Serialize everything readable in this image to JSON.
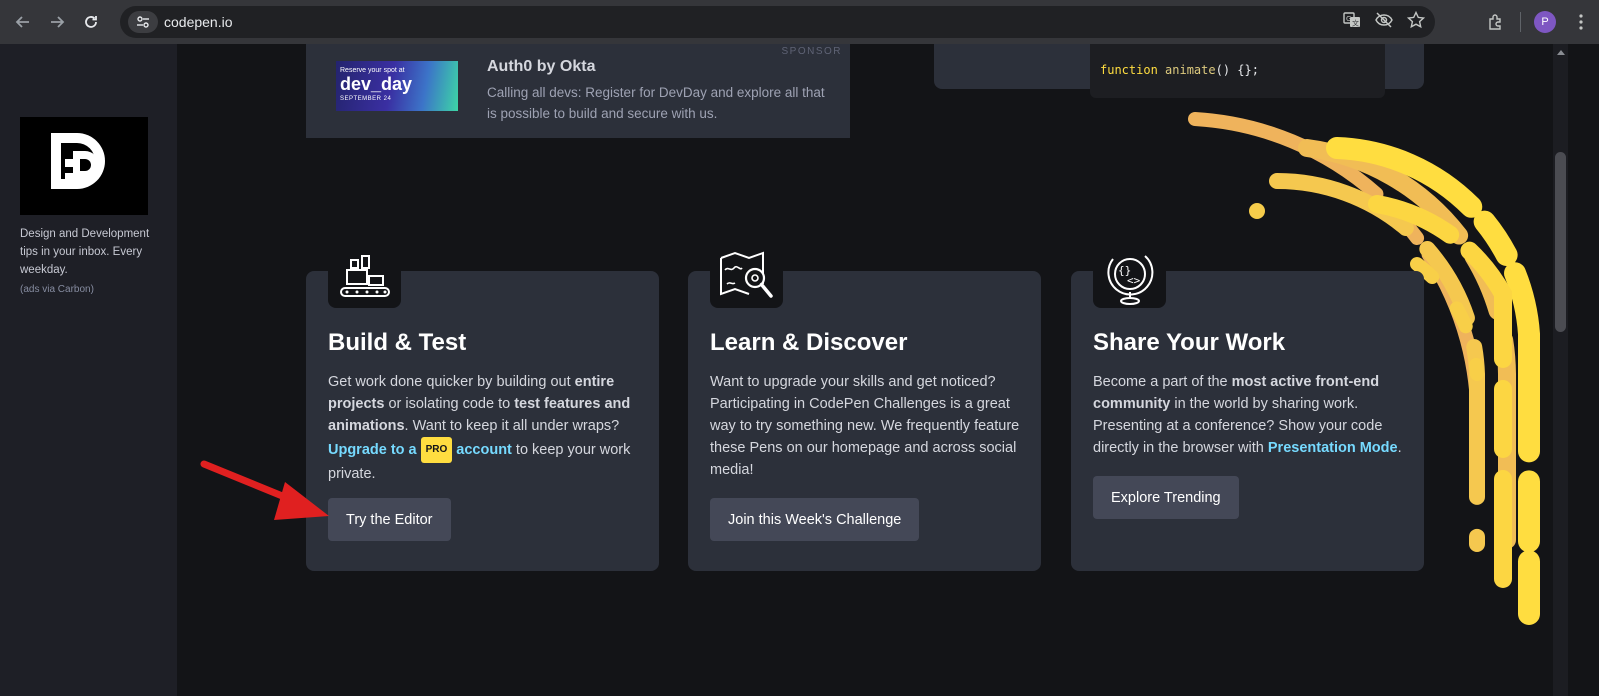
{
  "browser": {
    "url": "codepen.io",
    "profile_initial": "P"
  },
  "sidebar": {
    "ad_text": "Design and Development tips in your inbox. Every weekday.",
    "ad_via": "(ads via Carbon)"
  },
  "sponsor": {
    "tag": "SPONSOR",
    "image_small": "Reserve your spot at",
    "image_big": "dev_day",
    "image_date": "SEPTEMBER 24",
    "title": "Auth0 by Okta",
    "description": "Calling all devs: Register for DevDay and explore all that is possible to build and secure with us."
  },
  "code_snippet": {
    "keyword": "function",
    "name": "animate",
    "rest": "() {};"
  },
  "cards": [
    {
      "title": "Build & Test",
      "body": {
        "t1": "Get work done quicker by building out ",
        "b1": "entire projects",
        "t2": " or isolating code to ",
        "b2": "test features and animations",
        "t3": ". Want to keep it all under wraps? ",
        "link1": "Upgrade to a",
        "pro": "PRO",
        "link2": "account",
        "t4": " to keep your work private."
      },
      "button": "Try the Editor"
    },
    {
      "title": "Learn & Discover",
      "body": "Want to upgrade your skills and get noticed? Participating in CodePen Challenges is a great way to try something new. We frequently feature these Pens on our homepage and across social media!",
      "button": "Join this Week's Challenge"
    },
    {
      "title": "Share Your Work",
      "body": {
        "t1": "Become a part of the ",
        "b1": "most active front-end community",
        "t2": " in the world by sharing work. Presenting at a conference? Show your code directly in the browser with ",
        "link": "Presentation Mode",
        "t3": "."
      },
      "button": "Explore Trending"
    }
  ],
  "colors": {
    "accent_yellow": "#ffdd40",
    "link_blue": "#76daff",
    "card_bg": "#2c303a",
    "page_bg": "#131417",
    "arrow_red": "#e02020"
  }
}
